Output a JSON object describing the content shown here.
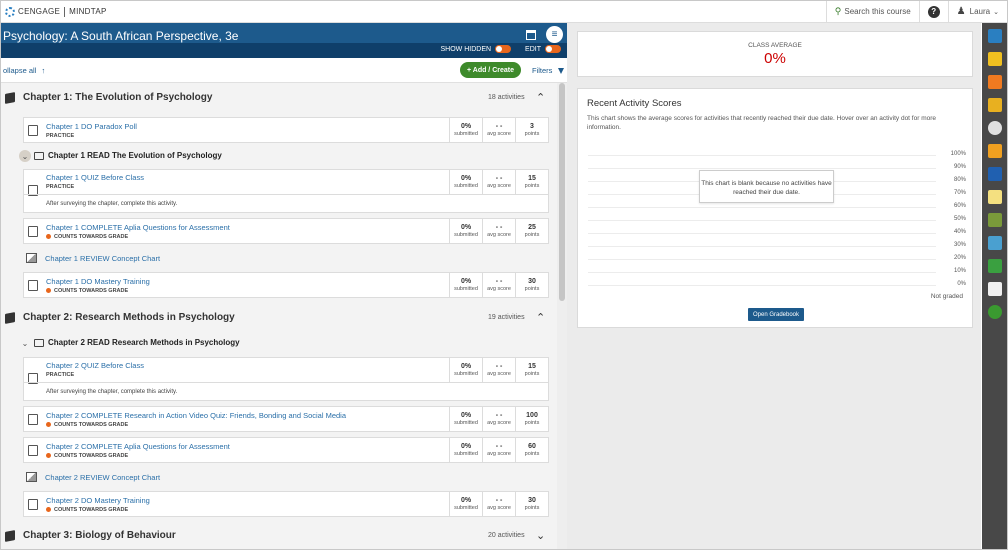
{
  "topbar": {
    "brand_left": "CENGAGE",
    "brand_right": "MINDTAP",
    "search_label": "Search this course",
    "help_label": "?",
    "user_name": "Laura"
  },
  "header": {
    "course_title": "Psychology: A South African Perspective, 3e",
    "show_hidden_label": "SHOW HIDDEN",
    "edit_label": "EDIT"
  },
  "actions": {
    "collapse_label": "ollapse all",
    "add_create_label": "+ Add / Create",
    "filters_label": "Filters"
  },
  "activity_labels": {
    "submitted": "submitted",
    "avg_score": "avg score",
    "points": "points"
  },
  "chapters": [
    {
      "title": "Chapter 1: The Evolution of Psychology",
      "count": "18 activities",
      "folder": "Chapter 1 READ The Evolution of Psychology",
      "activities": [
        {
          "name": "Chapter 1 DO Paradox Poll",
          "tag": "PRACTICE",
          "submitted": "0%",
          "avg": "- -",
          "points": "3",
          "note": ""
        },
        {
          "name": "Chapter 1 QUIZ Before Class",
          "tag": "PRACTICE",
          "submitted": "0%",
          "avg": "- -",
          "points": "15",
          "note": "After surveying the chapter, complete this activity."
        },
        {
          "name": "Chapter 1 COMPLETE Aplia Questions for Assessment",
          "tag": "COUNTS TOWARDS GRADE",
          "submitted": "0%",
          "avg": "- -",
          "points": "25",
          "note": ""
        },
        {
          "name": "Chapter 1 REVIEW Concept Chart"
        },
        {
          "name": "Chapter 1 DO Mastery Training",
          "tag": "COUNTS TOWARDS GRADE",
          "submitted": "0%",
          "avg": "- -",
          "points": "30",
          "note": ""
        }
      ]
    },
    {
      "title": "Chapter 2: Research Methods in Psychology",
      "count": "19 activities",
      "folder": "Chapter 2 READ Research Methods in Psychology",
      "activities": [
        {
          "name": "Chapter 2 QUIZ Before Class",
          "tag": "PRACTICE",
          "submitted": "0%",
          "avg": "- -",
          "points": "15",
          "note": "After surveying the chapter, complete this activity."
        },
        {
          "name": "Chapter 2 COMPLETE Research in Action Video Quiz: Friends, Bonding and Social Media",
          "tag": "COUNTS TOWARDS GRADE",
          "submitted": "0%",
          "avg": "- -",
          "points": "100",
          "note": ""
        },
        {
          "name": "Chapter 2 COMPLETE Aplia Questions for Assessment",
          "tag": "COUNTS TOWARDS GRADE",
          "submitted": "0%",
          "avg": "- -",
          "points": "60",
          "note": ""
        },
        {
          "name": "Chapter 2 REVIEW Concept Chart"
        },
        {
          "name": "Chapter 2 DO Mastery Training",
          "tag": "COUNTS TOWARDS GRADE",
          "submitted": "0%",
          "avg": "- -",
          "points": "30",
          "note": ""
        }
      ]
    },
    {
      "title": "Chapter 3: Biology of Behaviour",
      "count": "20 activities"
    }
  ],
  "right": {
    "class_average_label": "CLASS AVERAGE",
    "class_average_value": "0%",
    "recent_title": "Recent Activity Scores",
    "recent_desc": "This chart shows the average scores for activities that recently reached their due date. Hover over an activity dot for more information.",
    "y_ticks": [
      "100%",
      "90%",
      "80%",
      "70%",
      "60%",
      "50%",
      "40%",
      "30%",
      "20%",
      "10%",
      "0%"
    ],
    "blank_message": "This chart is blank because no activities have reached their due date.",
    "not_graded_label": "Not graded",
    "open_gradebook_label": "Open Gradebook"
  },
  "colors": {
    "header_blue": "#1d5a8c",
    "header_dark": "#0f3f6a",
    "accent_green": "#3e8a2b",
    "accent_orange": "#e8661c",
    "red_value": "#cc0000"
  },
  "dock_apps": [
    "cloud-app-icon",
    "pen-app-icon",
    "rss-app-icon",
    "dictionary-app-icon",
    "timer-app-icon",
    "badge-app-icon",
    "notebook-app-icon",
    "note-app-icon",
    "share-app-icon",
    "globe-app-icon",
    "board-app-icon",
    "message-app-icon",
    "ring-app-icon"
  ]
}
